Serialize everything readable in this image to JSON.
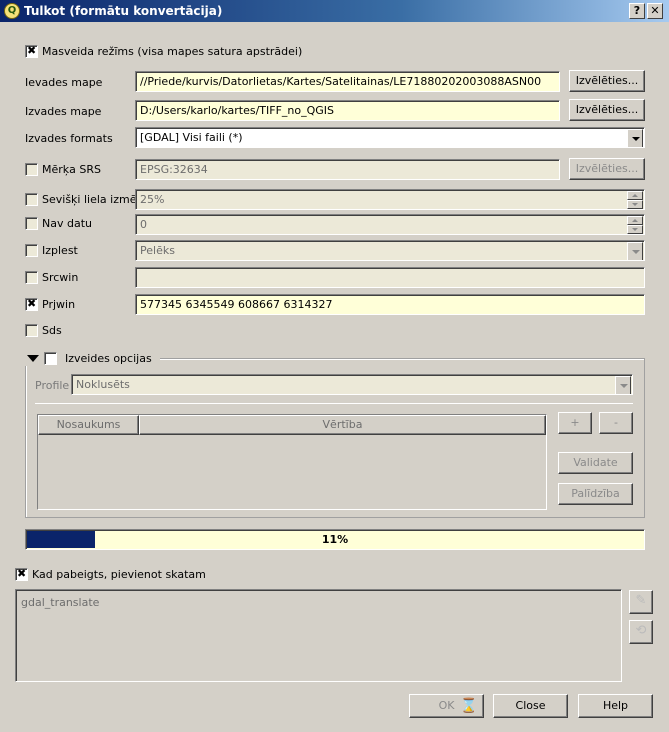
{
  "window": {
    "title": "Tulkot (formātu konvertācija)",
    "help_btn": "?",
    "close_btn": "✕"
  },
  "batch_mode": {
    "label": "Masveida režīms (visa mapes satura apstrādei)",
    "checked": true
  },
  "input_dir": {
    "label": "Ievades mape",
    "value": "//Priede/kurvis/Datorlietas/Kartes/Satelitainas/LE71880202003088ASN00",
    "button": "Izvēlēties..."
  },
  "output_dir": {
    "label": "Izvades mape",
    "value": "D:/Users/karlo/kartes/TIFF_no_QGIS",
    "button": "Izvēlēties..."
  },
  "output_format": {
    "label": "Izvades formats",
    "value": "[GDAL] Visi faili (*)"
  },
  "target_srs": {
    "label": "Mērķa SRS",
    "value": "EPSG:32634",
    "button": "Izvēlēties..."
  },
  "resize": {
    "label": "Sevišķi liela izmēr",
    "value": "25%"
  },
  "no_data": {
    "label": "Nav datu",
    "value": "0"
  },
  "expand": {
    "label": "Izplest",
    "value": "Pelēks"
  },
  "srcwin": {
    "label": "Srcwin",
    "value": ""
  },
  "prjwin": {
    "label": "Prjwin",
    "value": "577345 6345549 608667 6314327",
    "checked": true
  },
  "sds": {
    "label": "Sds"
  },
  "creation_options": {
    "label": "Izveides opcijas",
    "profile_label": "Profile",
    "profile_value": "Noklusēts",
    "col_name": "Nosaukums",
    "col_value": "Vērtība",
    "add_btn": "+",
    "remove_btn": "-",
    "validate_btn": "Validate",
    "help_btn": "Palīdzība"
  },
  "progress": {
    "value": 11,
    "label": "11%"
  },
  "load_when_done": {
    "label": "Kad pabeigts, pievienot skatam",
    "checked": true
  },
  "command": {
    "text": "gdal_translate"
  },
  "buttons": {
    "ok": "OK",
    "close": "Close",
    "help": "Help"
  },
  "colors": {
    "progress_fill": "#0a246a",
    "input_bg": "#ffffd8",
    "title_start": "#0a246a"
  }
}
